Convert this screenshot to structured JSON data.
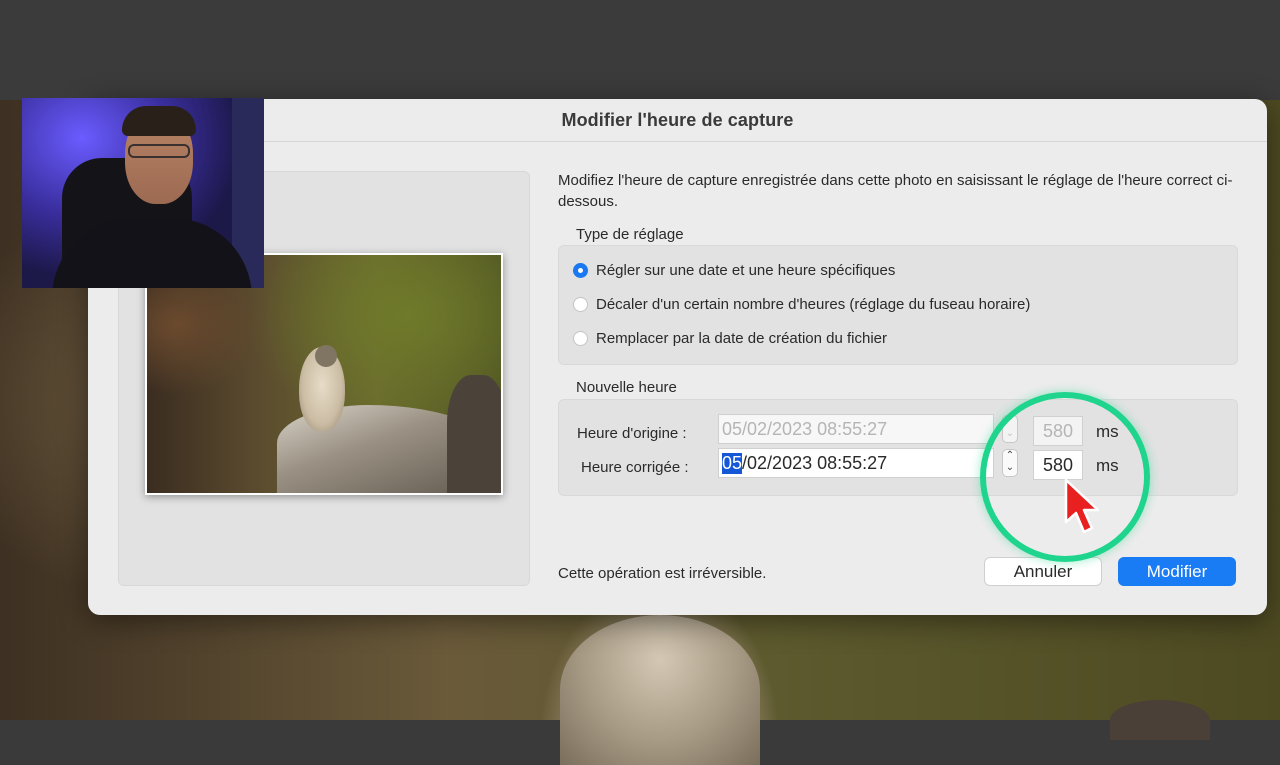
{
  "dialog": {
    "title": "Modifier l'heure de capture",
    "description": "Modifiez l'heure de capture enregistrée dans cette photo en saisissant le réglage de l'heure correct ci-dessous."
  },
  "adjust_type": {
    "label": "Type de réglage",
    "options": [
      {
        "label": "Régler sur une date et une heure spécifiques",
        "selected": true
      },
      {
        "label": "Décaler d'un certain nombre d'heures (réglage du fuseau horaire)",
        "selected": false
      },
      {
        "label": "Remplacer par la date de création du fichier",
        "selected": false
      }
    ]
  },
  "new_time": {
    "label": "Nouvelle heure",
    "original": {
      "label": "Heure d'origine :",
      "value": "05/02/2023 08:55:27",
      "ms": "580"
    },
    "corrected": {
      "label": "Heure corrigée :",
      "value_selected": "05",
      "value_rest": "/02/2023 08:55:27",
      "ms": "580"
    },
    "ms_unit": "ms"
  },
  "footer": {
    "note": "Cette opération est irréversible.",
    "cancel_label": "Annuler",
    "ok_label": "Modifier"
  },
  "icons": {
    "stepper": "stepper-icon",
    "cursor": "mouse-pointer-icon"
  },
  "colors": {
    "accent": "#1a7cf4",
    "highlight": "#1fd48c",
    "cursor": "#e82020"
  }
}
